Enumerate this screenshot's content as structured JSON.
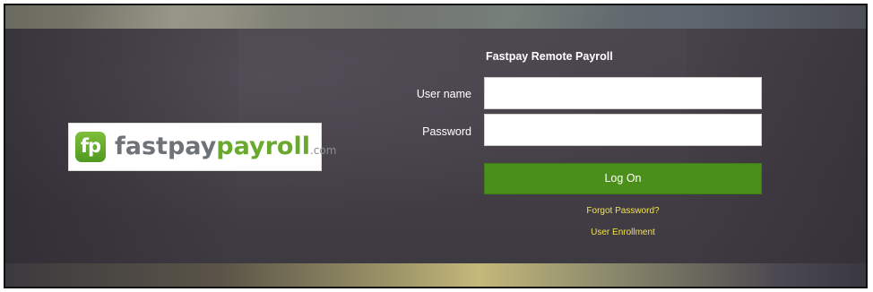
{
  "app": {
    "title": "Fastpay Remote Payroll"
  },
  "logo": {
    "badge_text": "fp",
    "wordmark_part1": "fastpay",
    "wordmark_part2": "payroll",
    "wordmark_part3": ".com"
  },
  "form": {
    "username_label": "User name",
    "username_value": "",
    "password_label": "Password",
    "password_value": "",
    "logon_label": "Log On"
  },
  "links": {
    "forgot_password": "Forgot Password?",
    "user_enrollment": "User Enrollment"
  },
  "colors": {
    "accent_green": "#4a8f1a",
    "link_yellow": "#f2e24a",
    "background": "#454048"
  }
}
